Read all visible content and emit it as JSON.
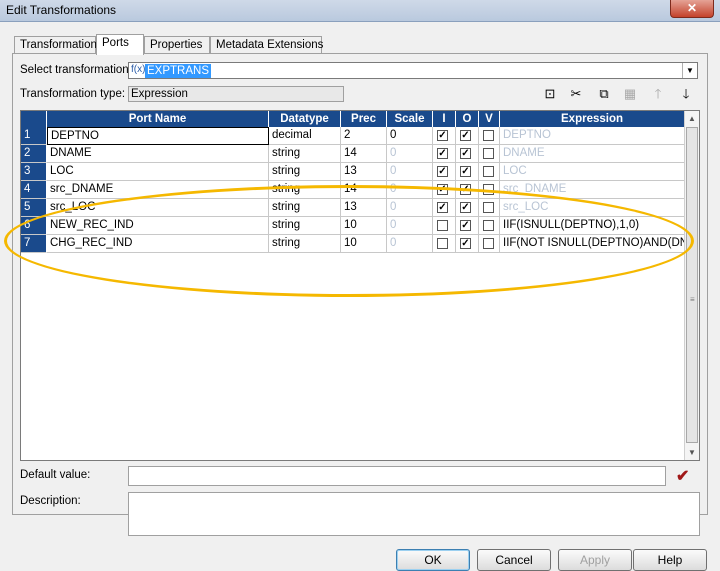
{
  "window": {
    "title": "Edit Transformations",
    "close_label": "✕"
  },
  "tabs": [
    {
      "label": "Transformation"
    },
    {
      "label": "Ports"
    },
    {
      "label": "Properties"
    },
    {
      "label": "Metadata Extensions"
    }
  ],
  "select_transformation": {
    "label": "Select transformation:",
    "value": "EXPTRANS",
    "icon": "f(x)"
  },
  "transformation_type": {
    "label": "Transformation type:",
    "value": "Expression"
  },
  "toolbar": [
    {
      "name": "new-port-icon",
      "glyph": "⊡",
      "enabled": true
    },
    {
      "name": "cut-icon",
      "glyph": "✂",
      "enabled": true
    },
    {
      "name": "copy-icon",
      "glyph": "⧉",
      "enabled": true
    },
    {
      "name": "paste-icon",
      "glyph": "▦",
      "enabled": false
    },
    {
      "name": "move-up-icon",
      "glyph": "🡑",
      "enabled": false
    },
    {
      "name": "move-down-icon",
      "glyph": "🡓",
      "enabled": true
    }
  ],
  "grid": {
    "columns": [
      "Port Name",
      "Datatype",
      "Prec",
      "Scale",
      "I",
      "O",
      "V",
      "Expression"
    ],
    "rows": [
      {
        "num": "1",
        "name": "DEPTNO",
        "datatype": "decimal",
        "prec": "2",
        "scale": "0",
        "scale_dim": false,
        "i": true,
        "o": true,
        "v": false,
        "expression": "DEPTNO",
        "expr_dim": true
      },
      {
        "num": "2",
        "name": "DNAME",
        "datatype": "string",
        "prec": "14",
        "scale": "0",
        "scale_dim": true,
        "i": true,
        "o": true,
        "v": false,
        "expression": "DNAME",
        "expr_dim": true
      },
      {
        "num": "3",
        "name": "LOC",
        "datatype": "string",
        "prec": "13",
        "scale": "0",
        "scale_dim": true,
        "i": true,
        "o": true,
        "v": false,
        "expression": "LOC",
        "expr_dim": true
      },
      {
        "num": "4",
        "name": "src_DNAME",
        "datatype": "string",
        "prec": "14",
        "scale": "0",
        "scale_dim": true,
        "i": true,
        "o": true,
        "v": false,
        "expression": "src_DNAME",
        "expr_dim": true
      },
      {
        "num": "5",
        "name": "src_LOC",
        "datatype": "string",
        "prec": "13",
        "scale": "0",
        "scale_dim": true,
        "i": true,
        "o": true,
        "v": false,
        "expression": "src_LOC",
        "expr_dim": true
      },
      {
        "num": "6",
        "name": "NEW_REC_IND",
        "datatype": "string",
        "prec": "10",
        "scale": "0",
        "scale_dim": true,
        "i": false,
        "o": true,
        "v": false,
        "expression": "IIF(ISNULL(DEPTNO),1,0)",
        "expr_dim": false
      },
      {
        "num": "7",
        "name": "CHG_REC_IND",
        "datatype": "string",
        "prec": "10",
        "scale": "0",
        "scale_dim": true,
        "i": false,
        "o": true,
        "v": false,
        "expression": "IIF(NOT ISNULL(DEPTNO)AND(DN...",
        "expr_dim": false
      }
    ]
  },
  "default_value": {
    "label": "Default value:",
    "value": ""
  },
  "description": {
    "label": "Description:",
    "value": ""
  },
  "buttons": {
    "ok": "OK",
    "cancel": "Cancel",
    "apply": "Apply",
    "help": "Help"
  },
  "colors": {
    "header_blue": "#1a4a8c",
    "highlight_ellipse": "#f5b800",
    "select_highlight": "#3399ff"
  }
}
